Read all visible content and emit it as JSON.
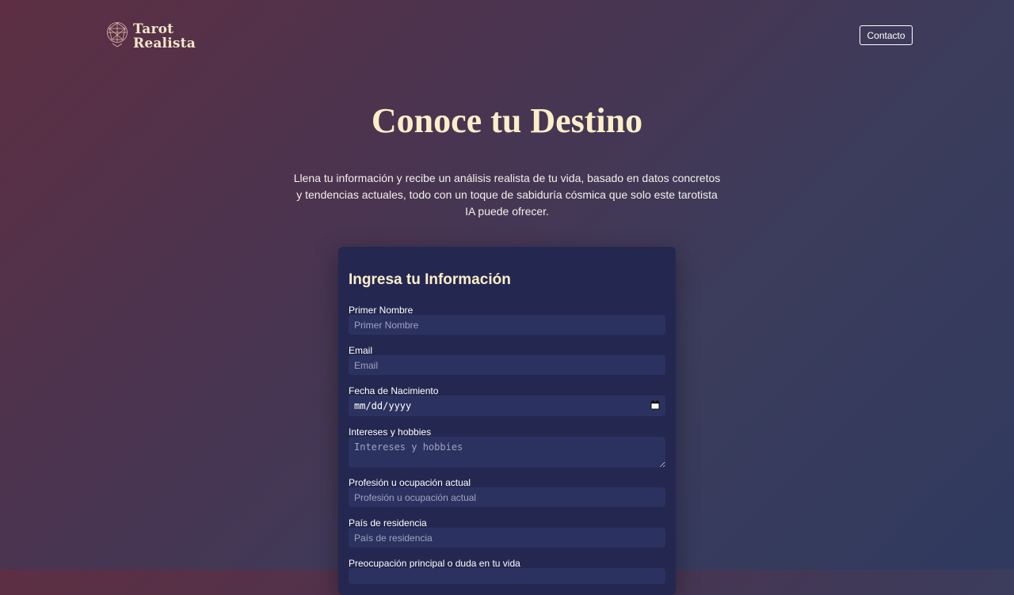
{
  "header": {
    "logo_line1": "Tarot",
    "logo_line2": "Realista",
    "contact_label": "Contacto"
  },
  "hero": {
    "title": "Conoce tu Destino",
    "subtitle": "Llena tu información y recibe un análisis realista de tu vida, basado en datos concretos y tendencias actuales, todo con un toque de sabiduría cósmica que solo este tarotista IA puede ofrecer."
  },
  "form": {
    "title": "Ingresa tu Información",
    "fields": {
      "first_name": {
        "label": "Primer Nombre",
        "placeholder": "Primer Nombre"
      },
      "email": {
        "label": "Email",
        "placeholder": "Email"
      },
      "birthdate": {
        "label": "Fecha de Nacimiento",
        "value": "mm/dd/yyyy"
      },
      "interests": {
        "label": "Intereses y hobbies",
        "placeholder": "Intereses y hobbies"
      },
      "profession": {
        "label": "Profesión u ocupación actual",
        "placeholder": "Profesión u ocupación actual"
      },
      "country": {
        "label": "País de residencia",
        "placeholder": "País de residencia"
      },
      "concern": {
        "label": "Preocupación principal o duda en tu vida"
      }
    }
  },
  "icons": {
    "logo": "crystal-ball-icon",
    "calendar": "calendar-icon"
  },
  "colors": {
    "accent_cream": "#fbeec9",
    "card_bg": "#242850",
    "field_bg": "#2c3260"
  }
}
